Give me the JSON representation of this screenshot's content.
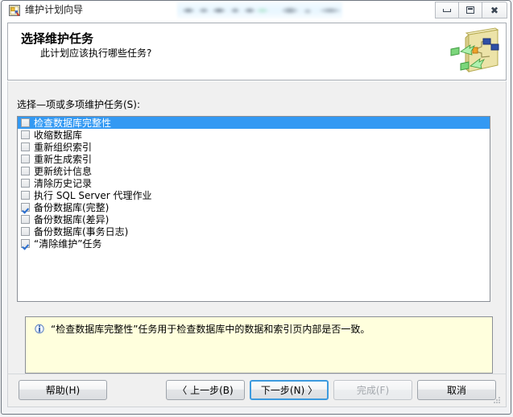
{
  "window": {
    "title": "维护计划向导",
    "title_icon": "wizard-document-icon",
    "redacted_title": "",
    "controls": {
      "minimize": "最小化",
      "maximize": "最大化",
      "close": "关闭"
    }
  },
  "header": {
    "title": "选择维护任务",
    "subtitle": "此计划应该执行哪些任务?",
    "icon": "maintenance-plan-icon"
  },
  "main": {
    "list_label": "选择—项或多项维护任务(S):",
    "tasks": [
      {
        "label": "检查数据库完整性",
        "checked": false,
        "selected": true
      },
      {
        "label": "收缩数据库",
        "checked": false,
        "selected": false
      },
      {
        "label": "重新组织索引",
        "checked": false,
        "selected": false
      },
      {
        "label": "重新生成索引",
        "checked": false,
        "selected": false
      },
      {
        "label": "更新统计信息",
        "checked": false,
        "selected": false
      },
      {
        "label": "清除历史记录",
        "checked": false,
        "selected": false
      },
      {
        "label": "执行 SQL Server 代理作业",
        "checked": false,
        "selected": false
      },
      {
        "label": "备份数据库(完整)",
        "checked": true,
        "selected": false
      },
      {
        "label": "备份数据库(差异)",
        "checked": false,
        "selected": false
      },
      {
        "label": "备份数据库(事务日志)",
        "checked": false,
        "selected": false
      },
      {
        "label": "“清除维护”任务",
        "checked": true,
        "selected": false
      }
    ],
    "info": {
      "icon": "info-icon",
      "text": "“检查数据库完整性”任务用于检查数据库中的数据和索引页内部是否一致。"
    }
  },
  "footer": {
    "help_label": "帮助(H)",
    "back_label": "〈 上一步(B)",
    "next_label": "下一步(N) 〉",
    "finish_label": "完成(F)",
    "cancel_label": "取消"
  },
  "colors": {
    "selection_blue": "#3399f3",
    "focus_blue": "#3c9ade",
    "info_background": "#ffffdd",
    "body_background": "#f0f0f0"
  }
}
